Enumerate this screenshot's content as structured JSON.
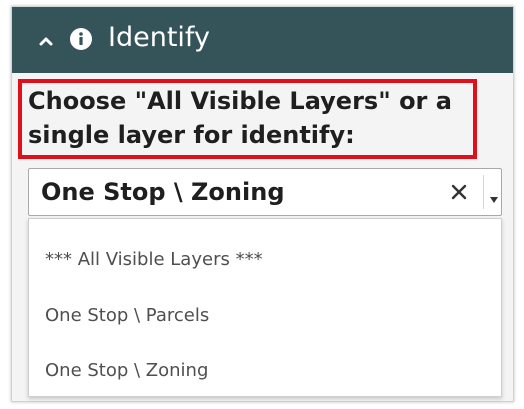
{
  "header": {
    "title": "Identify",
    "collapse_icon": "chevron-up-icon",
    "info_icon": "info-icon",
    "background_color": "#34545a"
  },
  "instruction": {
    "text": "Choose \"All Visible Layers\" or a single layer for identify:",
    "highlight_color": "#e0101a"
  },
  "layer_select": {
    "selected": "One Stop \\ Zoning",
    "clear_icon": "close-icon",
    "dropdown_icon": "caret-down-icon"
  },
  "options": [
    {
      "label": "*** All Visible Layers ***"
    },
    {
      "label": "One Stop \\ Parcels"
    },
    {
      "label": "One Stop \\ Zoning"
    }
  ]
}
